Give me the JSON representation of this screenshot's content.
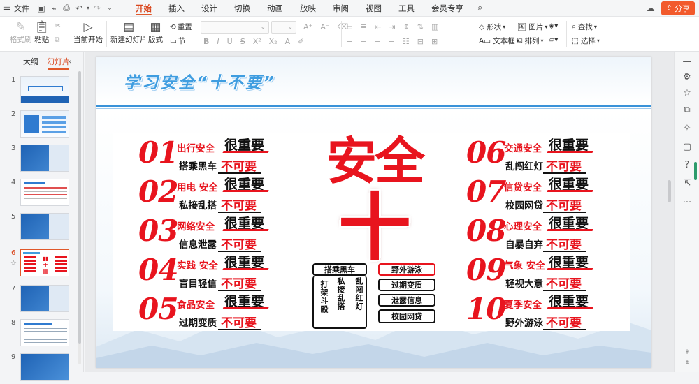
{
  "menubar": {
    "file_label": "文件",
    "tabs": [
      "开始",
      "插入",
      "设计",
      "切换",
      "动画",
      "放映",
      "审阅",
      "视图",
      "工具",
      "会员专享"
    ],
    "active_tab": "开始",
    "share_label": "分享"
  },
  "ribbon": {
    "format_painter": "格式刷",
    "paste": "粘贴",
    "from_current": "当前开始",
    "new_slide": "新建幻灯片",
    "layout": "版式",
    "reset": "重置",
    "section": "节",
    "shape": "形状",
    "picture": "图片",
    "textbox": "文本框",
    "arrange": "排列",
    "find": "查找",
    "select": "选择"
  },
  "left_panel": {
    "tab_outline": "大纲",
    "tab_slides": "幻灯片",
    "slide_numbers": [
      "1",
      "2",
      "3",
      "4",
      "5",
      "6",
      "7",
      "8",
      "9"
    ],
    "active_slide": "6"
  },
  "slide": {
    "title": "学习安全“十不要”",
    "center_big": "安全",
    "center_ten": "十",
    "center_boxes": [
      "搭乘黑车",
      "野外游泳",
      "过期变质",
      "泄露信息",
      "校园网贷"
    ],
    "center_columns": [
      "打架斗殴",
      "私接乱搭",
      "乱闯红灯"
    ],
    "items": [
      {
        "num": "01",
        "category": "出行安全",
        "must": "很重要",
        "action": "搭乘黑车",
        "not": "不可要"
      },
      {
        "num": "02",
        "category": "用电 安全",
        "must": "很重要",
        "action": "私接乱搭",
        "not": "不可要"
      },
      {
        "num": "03",
        "category": "网络安全",
        "must": "很重要",
        "action": "信息泄露",
        "not": "不可要"
      },
      {
        "num": "04",
        "category": "实践 安全",
        "must": "很重要",
        "action": "盲目轻信",
        "not": "不可要"
      },
      {
        "num": "05",
        "category": "食品安全",
        "must": "很重要",
        "action": "过期变质",
        "not": "不可要"
      },
      {
        "num": "06",
        "category": "交通安全",
        "must": "很重要",
        "action": "乱闯红灯",
        "not": "不可要"
      },
      {
        "num": "07",
        "category": "信贷安全",
        "must": "很重要",
        "action": "校园网贷",
        "not": "不可要"
      },
      {
        "num": "08",
        "category": "心理安全",
        "must": "很重要",
        "action": "自暴自弃",
        "not": "不可要"
      },
      {
        "num": "09",
        "category": "气象 安全",
        "must": "很重要",
        "action": "轻视大意",
        "not": "不可要"
      },
      {
        "num": "10",
        "category": "夏季安全",
        "must": "很重要",
        "action": "野外游泳",
        "not": "不可要"
      }
    ]
  },
  "colors": {
    "accent": "#e0582a",
    "slide_red": "#e8141e",
    "title_blue": "#3f9de0"
  },
  "icons": [
    "menu-icon",
    "save-icon",
    "undo-icon",
    "redo-icon",
    "search-icon",
    "cloud-icon",
    "share-icon"
  ]
}
